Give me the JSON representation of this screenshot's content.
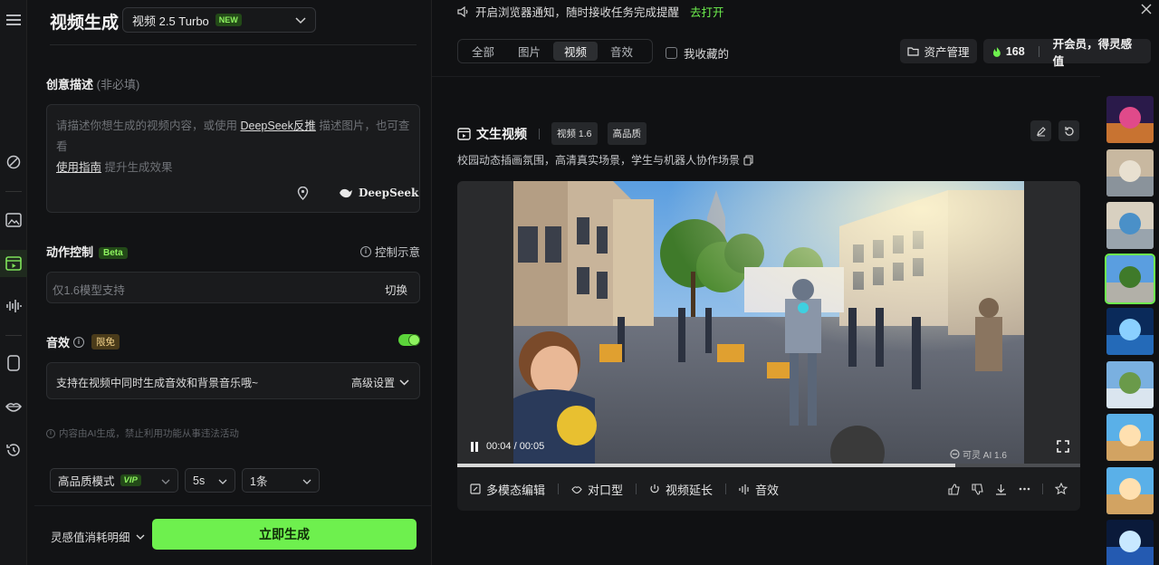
{
  "rail": {
    "items": [
      "menu-icon",
      "edit-sparkle-icon",
      "image-icon",
      "video-icon",
      "audio-wave-icon",
      "phone-icon",
      "lips-icon",
      "history-icon"
    ]
  },
  "panel": {
    "title": "视频生成",
    "model": {
      "name": "视频 2.5 Turbo",
      "badge": "NEW"
    },
    "creative": {
      "label": "创意描述",
      "optional": "(非必填)",
      "placeholder_a": "请描述你想生成的视频内容，或使用 ",
      "link_deepseek": "DeepSeek反推",
      "placeholder_b": " 描述图片，也可查看",
      "link_guide": "使用指南",
      "placeholder_c": " 提升生成效果",
      "deepseek_btn": "DeepSeek"
    },
    "motion": {
      "label": "动作控制",
      "badge": "Beta",
      "demo": "控制示意",
      "placeholder": "仅1.6模型支持",
      "switch": "切换"
    },
    "sfx": {
      "label": "音效",
      "badge": "限免",
      "enabled": true,
      "text": "支持在视频中同时生成音效和背景音乐哦~",
      "advanced": "高级设置"
    },
    "notice": "内容由AI生成，禁止利用功能从事违法活动",
    "mode": {
      "value": "高品质模式",
      "badge": "VIP"
    },
    "duration": "5s",
    "count": "1条",
    "cost_label": "灵感值消耗明细",
    "generate": "立即生成"
  },
  "main": {
    "notif": {
      "text": "开启浏览器通知，随时接收任务完成提醒",
      "action": "去打开"
    },
    "tabs": [
      {
        "label": "全部",
        "active": false
      },
      {
        "label": "图片",
        "active": false
      },
      {
        "label": "视频",
        "active": true
      },
      {
        "label": "音效",
        "active": false
      }
    ],
    "favorites": "我收藏的",
    "asset_button": "资产管理",
    "credits": {
      "value": "168",
      "promo": "开会员，得灵感值"
    },
    "card": {
      "title": "文生视频",
      "tags": [
        "视频 1.6",
        "高品质"
      ],
      "prompt": "校园动态插画氛围，高清真实场景，学生与机器人协作场景",
      "time": "00:04 / 00:05",
      "watermark": "可灵 AI 1.6",
      "progress": 0.8,
      "tools": [
        "多模态编辑",
        "对口型",
        "视频延长",
        "音效"
      ]
    }
  },
  "thumbs": [
    {
      "name": "fox-anime",
      "selected": false
    },
    {
      "name": "robot-lab",
      "selected": false
    },
    {
      "name": "robot-class",
      "selected": false
    },
    {
      "name": "campus-scene",
      "selected": true
    },
    {
      "name": "jellyfish-blue",
      "selected": false
    },
    {
      "name": "cartoon-sheep",
      "selected": false
    },
    {
      "name": "shiba-cartoon",
      "selected": false
    },
    {
      "name": "shiba-cartoon-2",
      "selected": false
    },
    {
      "name": "lightning-character",
      "selected": false
    }
  ]
}
